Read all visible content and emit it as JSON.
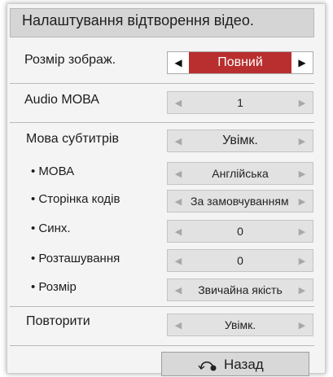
{
  "title": "Налаштування відтворення відео.",
  "rows": [
    {
      "label": "Розмір зображ.",
      "value": "Повний"
    },
    {
      "label": "Audio МОВА",
      "value": "1"
    },
    {
      "label": "Мова субтитрів",
      "value": "Увімк."
    },
    {
      "label": "• МОВА",
      "value": "Англійська"
    },
    {
      "label": "• Сторінка кодів",
      "value": "За замовчуванням"
    },
    {
      "label": "• Синх.",
      "value": "0"
    },
    {
      "label": "• Розташування",
      "value": "0"
    },
    {
      "label": "• Розмір",
      "value": "Звичайна якість"
    },
    {
      "label": "Повторити",
      "value": "Увімк."
    }
  ],
  "back_label": "Назад",
  "icons": {
    "left_arrow": "left-arrow",
    "right_arrow": "right-arrow",
    "back": "back-arrow-icon"
  },
  "colors": {
    "highlight": "#b92e2e",
    "panel": "#f4f4f4"
  }
}
